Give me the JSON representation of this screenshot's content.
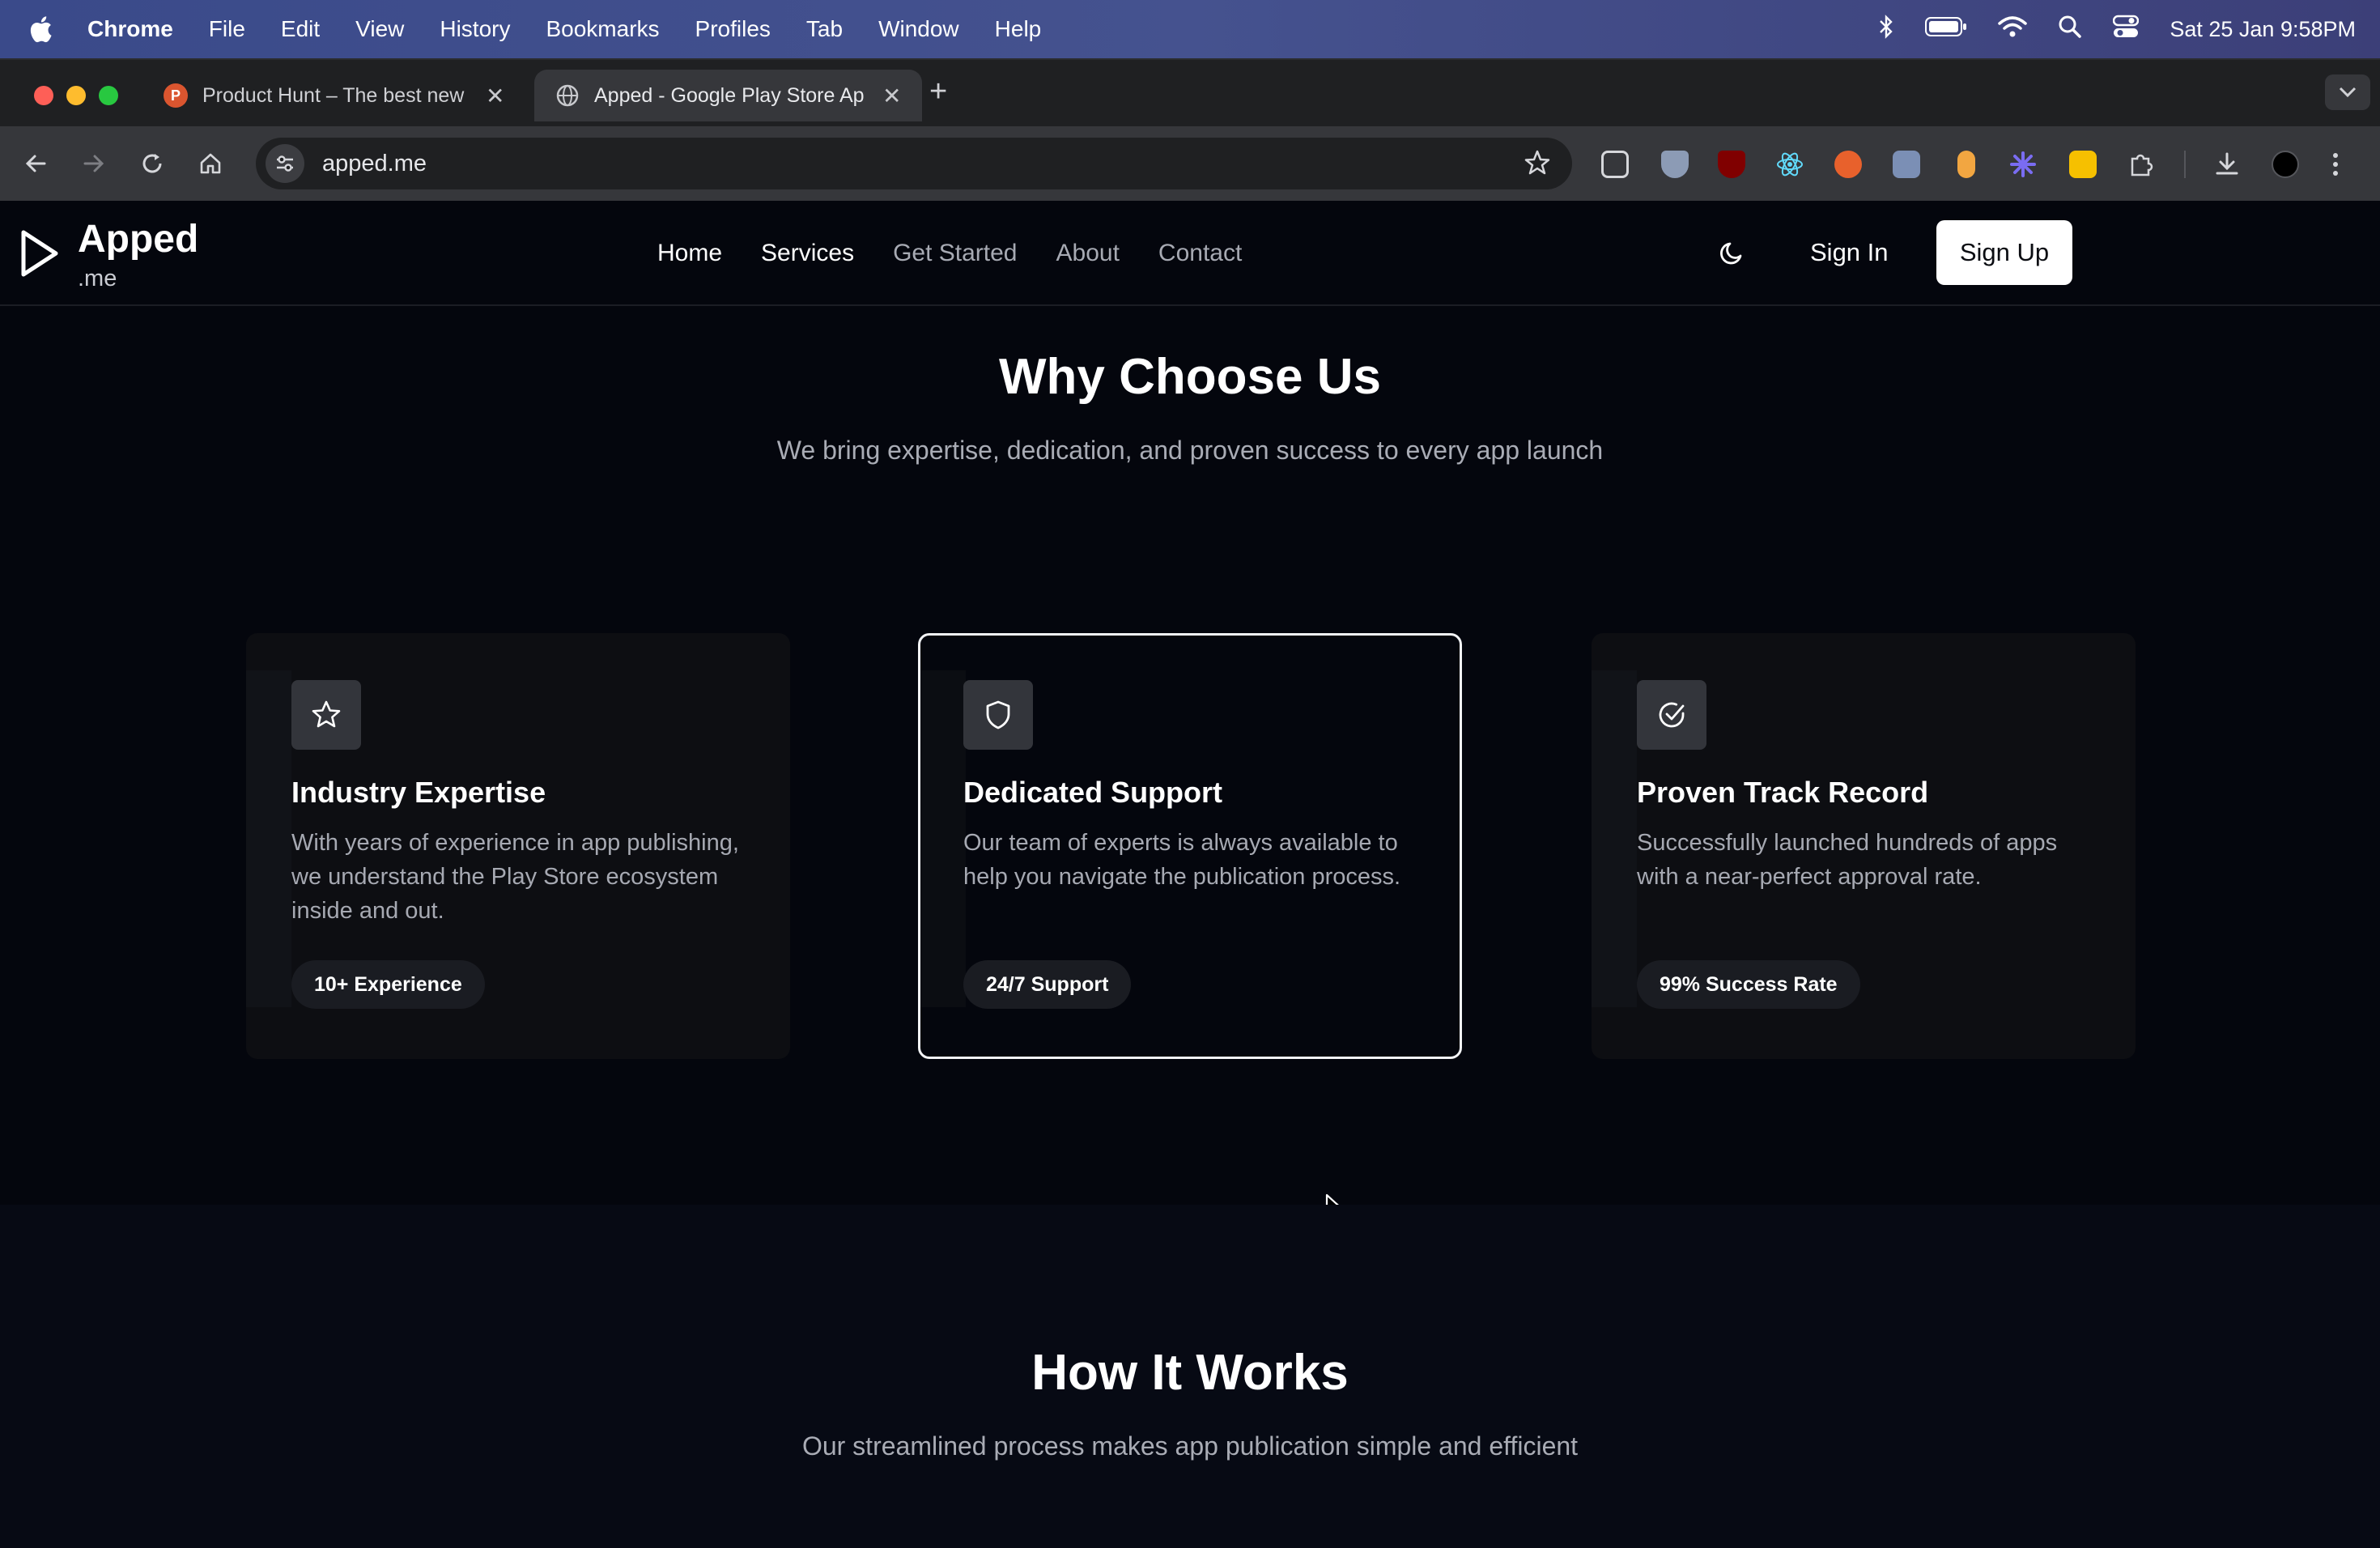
{
  "menubar": {
    "app": "Chrome",
    "items": [
      "File",
      "Edit",
      "View",
      "History",
      "Bookmarks",
      "Profiles",
      "Tab",
      "Window",
      "Help"
    ],
    "clock": "Sat 25 Jan  9:58PM",
    "status_icons": [
      "bluetooth-icon",
      "battery-icon",
      "wifi-icon",
      "spotlight-icon",
      "control-center-icon"
    ]
  },
  "browser": {
    "tabs": [
      {
        "title": "Product Hunt – The best new",
        "favicon": "P",
        "active": false
      },
      {
        "title": "Apped - Google Play Store Ap",
        "favicon": "globe",
        "active": true
      }
    ],
    "url": "apped.me"
  },
  "site": {
    "logo": {
      "name": "Apped",
      "suffix": ".me"
    },
    "nav": [
      "Home",
      "Services",
      "Get Started",
      "About",
      "Contact"
    ],
    "sign_in": "Sign In",
    "sign_up": "Sign Up",
    "why": {
      "title": "Why Choose Us",
      "subtitle": "We bring expertise, dedication, and proven success to every app launch",
      "cards": [
        {
          "icon": "star-icon",
          "title": "Industry Expertise",
          "desc": "With years of experience in app publishing, we understand the Play Store ecosystem inside and out.",
          "badge": "10+ Experience"
        },
        {
          "icon": "shield-icon",
          "title": "Dedicated Support",
          "desc": "Our team of experts is always available to help you navigate the publication process.",
          "badge": "24/7 Support"
        },
        {
          "icon": "check-circle-icon",
          "title": "Proven Track Record",
          "desc": "Successfully launched hundreds of apps with a near-perfect approval rate.",
          "badge": "99% Success Rate"
        }
      ]
    },
    "how": {
      "title": "How It Works",
      "subtitle": "Our streamlined process makes app publication simple and efficient"
    }
  }
}
